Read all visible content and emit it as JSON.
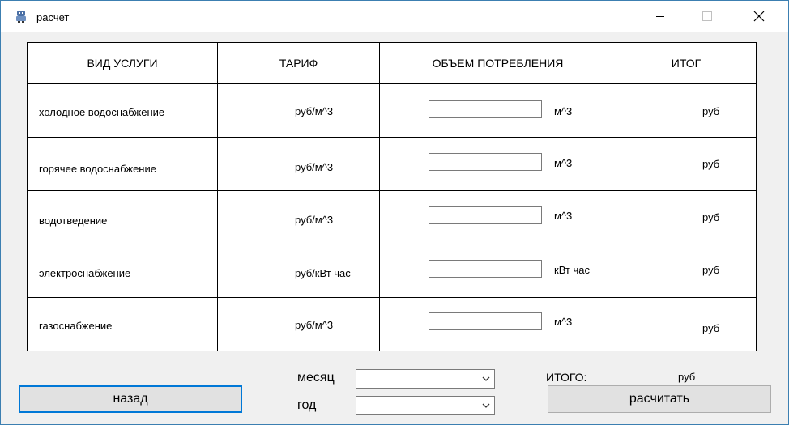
{
  "window": {
    "title": "расчет"
  },
  "table": {
    "headers": [
      "ВИД УСЛУГИ",
      "ТАРИФ",
      "ОБЪЕМ ПОТРЕБЛЕНИЯ",
      "ИТОГ"
    ],
    "rows": [
      {
        "service": "холодное водоснабжение",
        "tariff": "руб/м^3",
        "volume": "",
        "unit": "м^3",
        "total": "руб"
      },
      {
        "service": "горячее водоснабжение",
        "tariff": "руб/м^3",
        "volume": "",
        "unit": "м^3",
        "total": "руб"
      },
      {
        "service": "водотведение",
        "tariff": "руб/м^3",
        "volume": "",
        "unit": "м^3",
        "total": "руб"
      },
      {
        "service": "электроснабжение",
        "tariff": "руб/кВт час",
        "volume": "",
        "unit": "кВт час",
        "total": "руб"
      },
      {
        "service": "газоснабжение",
        "tariff": "руб/м^3",
        "volume": "",
        "unit": "м^3",
        "total": "руб"
      }
    ]
  },
  "footer": {
    "back_label": "назад",
    "month_label": "месяц",
    "month_value": "",
    "year_label": "год",
    "year_value": "",
    "total_label": "ИТОГО:",
    "total_unit": "руб",
    "calc_label": "расчитать"
  }
}
